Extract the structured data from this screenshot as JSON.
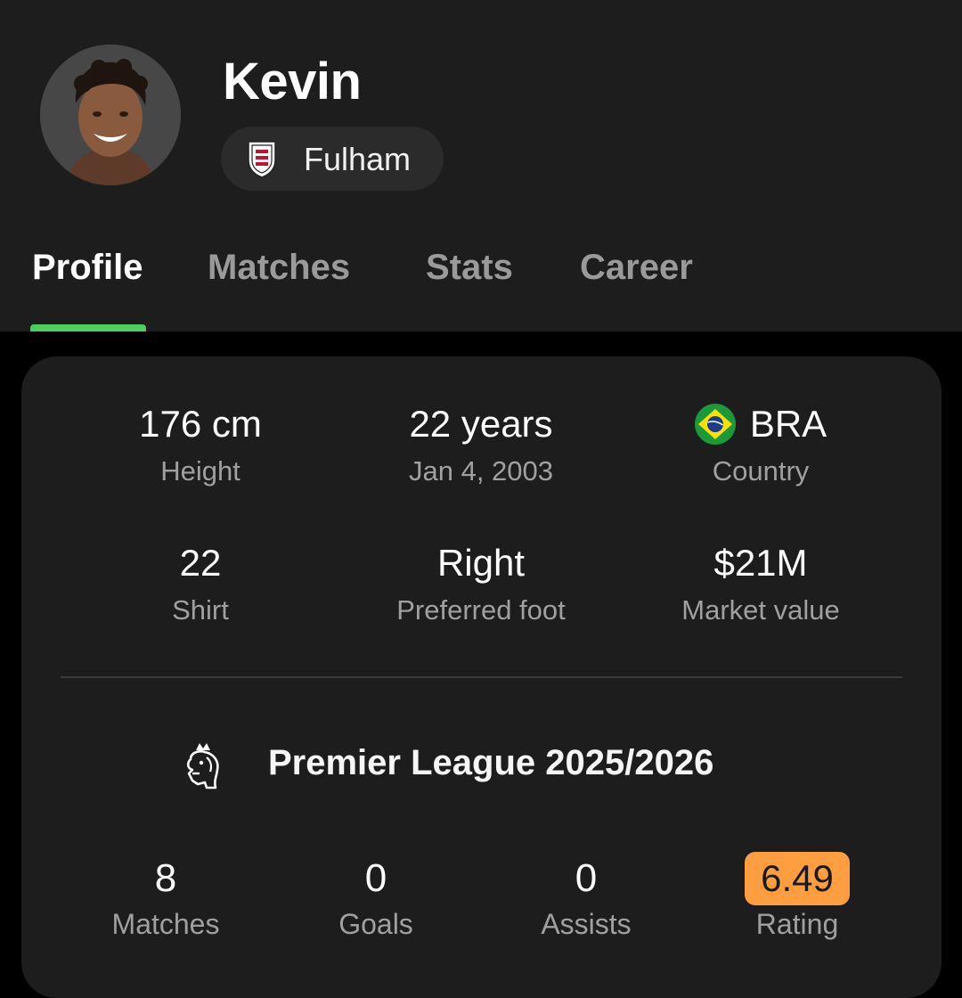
{
  "player": {
    "name": "Kevin",
    "team": "Fulham"
  },
  "tabs": [
    {
      "label": "Profile",
      "active": true
    },
    {
      "label": "Matches",
      "active": false
    },
    {
      "label": "Stats",
      "active": false
    },
    {
      "label": "Career",
      "active": false
    }
  ],
  "info": {
    "height_value": "176 cm",
    "height_label": "Height",
    "age_value": "22 years",
    "birth_date": "Jan 4, 2003",
    "country_value": "BRA",
    "country_label": "Country",
    "shirt_value": "22",
    "shirt_label": "Shirt",
    "foot_value": "Right",
    "foot_label": "Preferred foot",
    "market_value": "$21M",
    "market_label": "Market value"
  },
  "league": {
    "title": "Premier League 2025/2026",
    "icon": "premier-league-lion-icon"
  },
  "season_stats": {
    "matches_value": "8",
    "matches_label": "Matches",
    "goals_value": "0",
    "goals_label": "Goals",
    "assists_value": "0",
    "assists_label": "Assists",
    "rating_value": "6.49",
    "rating_label": "Rating"
  },
  "colors": {
    "accent_green": "#4ccf5c",
    "rating_orange": "#ff9e40",
    "background": "#000000",
    "surface": "#1d1d1d"
  }
}
